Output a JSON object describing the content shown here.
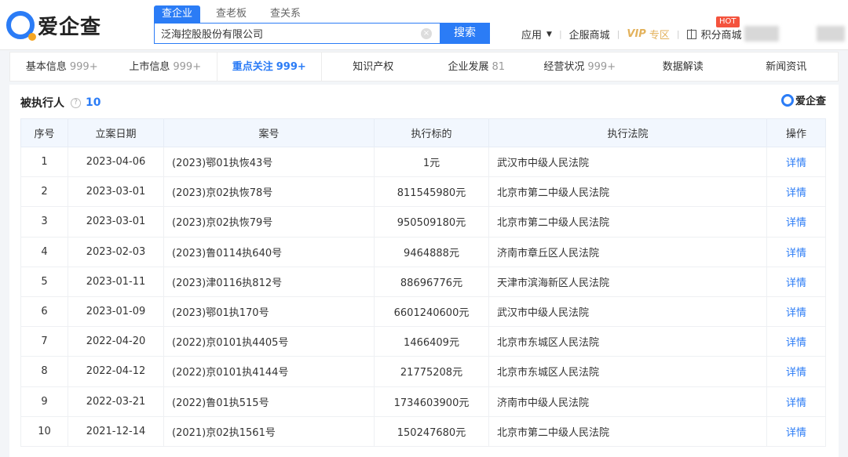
{
  "header": {
    "logo_text": "爱企查",
    "search_tabs": [
      "查企业",
      "查老板",
      "查关系"
    ],
    "search_value": "泛海控股股份有限公司",
    "search_button": "搜索",
    "clear_glyph": "×",
    "nav": {
      "app": "应用",
      "enterprise_mall": "企服商城",
      "vip": "VIP",
      "vip_zone": "专区",
      "points_mall": "积分商城",
      "hot_badge": "HOT"
    }
  },
  "tabs": [
    {
      "label": "基本信息",
      "count": "999+"
    },
    {
      "label": "上市信息",
      "count": "999+"
    },
    {
      "label": "重点关注",
      "count": "999+",
      "active": true
    },
    {
      "label": "知识产权",
      "count": ""
    },
    {
      "label": "企业发展",
      "count": "81"
    },
    {
      "label": "经营状况",
      "count": "999+"
    },
    {
      "label": "数据解读",
      "count": ""
    },
    {
      "label": "新闻资讯",
      "count": ""
    }
  ],
  "section": {
    "title": "被执行人",
    "help_glyph": "?",
    "count": "10",
    "brand": "爱企查"
  },
  "table": {
    "columns": [
      "序号",
      "立案日期",
      "案号",
      "执行标的",
      "执行法院",
      "操作"
    ],
    "rows": [
      [
        "1",
        "2023-04-06",
        "(2023)鄂01执恢43号",
        "1元",
        "武汉市中级人民法院",
        "详情"
      ],
      [
        "2",
        "2023-03-01",
        "(2023)京02执恢78号",
        "811545980元",
        "北京市第二中级人民法院",
        "详情"
      ],
      [
        "3",
        "2023-03-01",
        "(2023)京02执恢79号",
        "950509180元",
        "北京市第二中级人民法院",
        "详情"
      ],
      [
        "4",
        "2023-02-03",
        "(2023)鲁0114执640号",
        "9464888元",
        "济南市章丘区人民法院",
        "详情"
      ],
      [
        "5",
        "2023-01-11",
        "(2023)津0116执812号",
        "88696776元",
        "天津市滨海新区人民法院",
        "详情"
      ],
      [
        "6",
        "2023-01-09",
        "(2023)鄂01执170号",
        "6601240600元",
        "武汉市中级人民法院",
        "详情"
      ],
      [
        "7",
        "2022-04-20",
        "(2022)京0101执4405号",
        "1466409元",
        "北京市东城区人民法院",
        "详情"
      ],
      [
        "8",
        "2022-04-12",
        "(2022)京0101执4144号",
        "21775208元",
        "北京市东城区人民法院",
        "详情"
      ],
      [
        "9",
        "2022-03-21",
        "(2022)鲁01执515号",
        "1734603900元",
        "济南市中级人民法院",
        "详情"
      ],
      [
        "10",
        "2021-12-14",
        "(2021)京02执1561号",
        "150247680元",
        "北京市第二中级人民法院",
        "详情"
      ]
    ]
  }
}
